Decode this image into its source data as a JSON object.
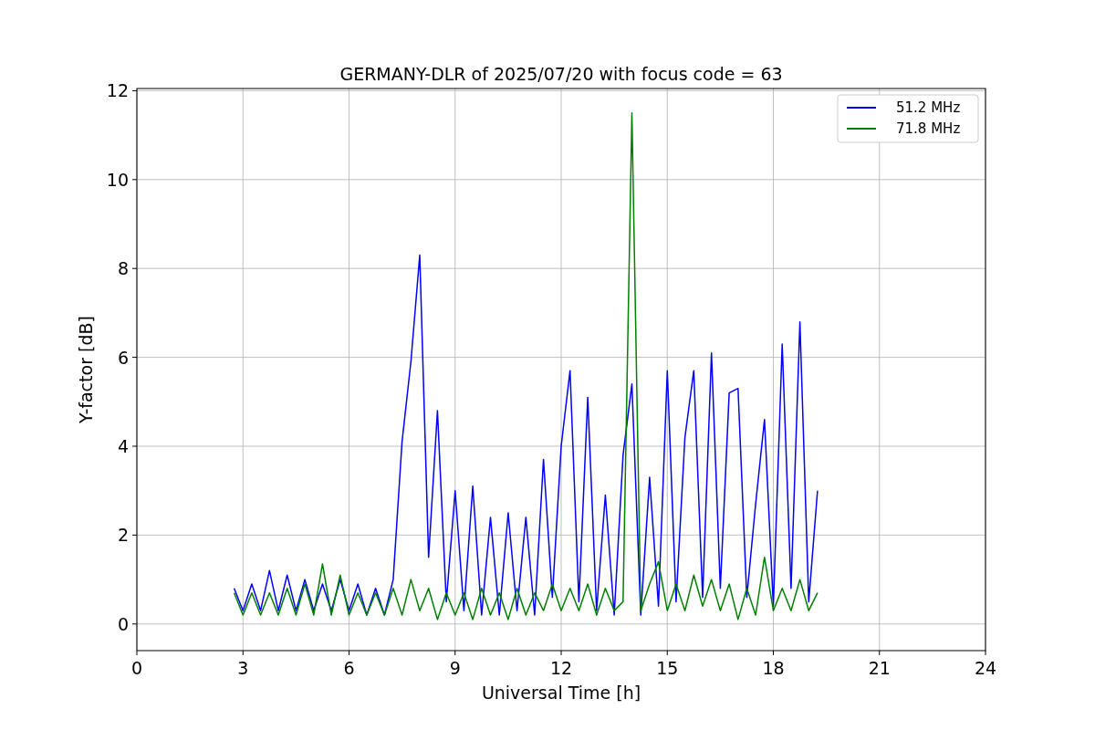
{
  "figure": {
    "chart_data": {
      "type": "line",
      "title": "GERMANY-DLR of 2025/07/20 with focus code = 63",
      "xlabel": "Universal Time [h]",
      "ylabel": "Y-factor [dB]",
      "xlim": [
        0,
        24
      ],
      "ylim": [
        -0.6,
        12.05
      ],
      "xticks": [
        0,
        3,
        6,
        9,
        12,
        15,
        18,
        21,
        24
      ],
      "yticks": [
        0,
        2,
        4,
        6,
        8,
        10,
        12
      ],
      "grid": true,
      "legend": true,
      "x": [
        2.75,
        3,
        3.25,
        3.5,
        3.75,
        4,
        4.25,
        4.5,
        4.75,
        5,
        5.25,
        5.5,
        5.75,
        6,
        6.25,
        6.5,
        6.75,
        7,
        7.25,
        7.5,
        7.75,
        8,
        8.25,
        8.5,
        8.75,
        9,
        9.25,
        9.5,
        9.75,
        10,
        10.25,
        10.5,
        10.75,
        11,
        11.25,
        11.5,
        11.75,
        12,
        12.25,
        12.5,
        12.75,
        13,
        13.25,
        13.5,
        13.75,
        14,
        14.25,
        14.5,
        14.75,
        15,
        15.25,
        15.5,
        15.75,
        16,
        16.25,
        16.5,
        16.75,
        17,
        17.25,
        17.5,
        17.75,
        18,
        18.25,
        18.5,
        18.75,
        19,
        19.25
      ],
      "series": [
        {
          "name": "51.2 MHz",
          "color": "#0000ff",
          "values": [
            0.8,
            0.3,
            0.9,
            0.3,
            1.2,
            0.3,
            1.1,
            0.3,
            1.0,
            0.3,
            0.9,
            0.3,
            1.0,
            0.3,
            0.9,
            0.2,
            0.8,
            0.2,
            1.0,
            4.1,
            5.9,
            8.3,
            1.5,
            4.8,
            0.5,
            3.0,
            0.3,
            3.1,
            0.2,
            2.4,
            0.2,
            2.5,
            0.3,
            2.4,
            0.2,
            3.7,
            0.6,
            4.0,
            5.7,
            0.5,
            5.1,
            0.3,
            2.9,
            0.2,
            3.8,
            5.4,
            0.2,
            3.3,
            0.4,
            5.7,
            0.5,
            4.2,
            5.7,
            0.6,
            6.1,
            0.8,
            5.2,
            5.3,
            0.6,
            2.7,
            4.6,
            0.4,
            6.3,
            0.8,
            6.8,
            0.5,
            3.0
          ]
        },
        {
          "name": "71.8 MHz",
          "color": "#008000",
          "values": [
            0.7,
            0.2,
            0.7,
            0.2,
            0.7,
            0.2,
            0.8,
            0.2,
            0.9,
            0.2,
            1.35,
            0.2,
            1.1,
            0.2,
            0.7,
            0.2,
            0.7,
            0.2,
            0.8,
            0.2,
            1.0,
            0.3,
            0.8,
            0.1,
            0.7,
            0.2,
            0.7,
            0.1,
            0.8,
            0.2,
            0.7,
            0.1,
            0.8,
            0.2,
            0.7,
            0.3,
            0.9,
            0.3,
            0.8,
            0.3,
            0.9,
            0.2,
            0.8,
            0.3,
            0.5,
            11.5,
            0.3,
            0.9,
            1.4,
            0.3,
            0.9,
            0.3,
            1.1,
            0.4,
            1.0,
            0.3,
            0.9,
            0.1,
            0.8,
            0.2,
            1.5,
            0.3,
            0.8,
            0.3,
            1.0,
            0.3,
            0.7
          ]
        }
      ]
    }
  }
}
